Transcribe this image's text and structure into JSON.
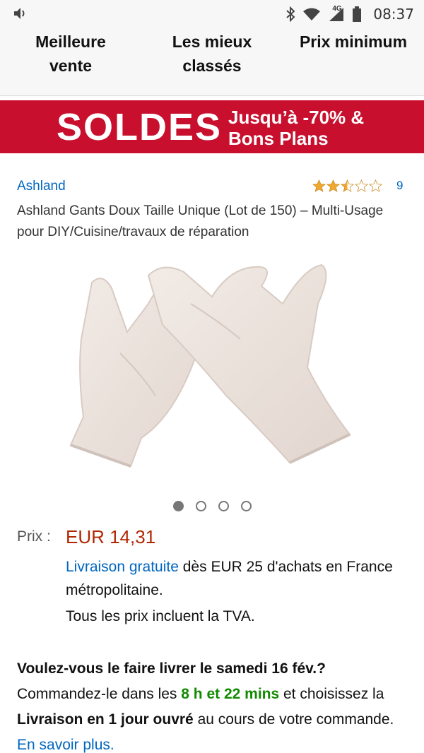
{
  "status_bar": {
    "time": "08:37",
    "network": "4G",
    "icons": [
      "volume-icon",
      "bluetooth-icon",
      "wifi-icon",
      "signal-icon",
      "battery-icon"
    ]
  },
  "sort_tabs": [
    {
      "label": "Meilleure\nvente"
    },
    {
      "label": "Les mieux\nclassés"
    },
    {
      "label": "Prix minimum"
    }
  ],
  "banner": {
    "title": "SOLDES",
    "subtitle": "Jusqu’à -70% &\nBons Plans",
    "color": "#c8102e"
  },
  "product": {
    "brand": "Ashland",
    "rating": 2.5,
    "rating_max": 5,
    "rating_count": "9",
    "title": "Ashland Gants Doux Taille Unique (Lot de 150) – Multi-Usage pour DIY/Cuisine/travaux de réparation",
    "image_icon": "gloves-image",
    "carousel_pages": 4,
    "carousel_active": 1
  },
  "price": {
    "label": "Prix :",
    "value": "EUR 14,31",
    "color": "#b12704"
  },
  "shipping": {
    "link": "Livraison gratuite",
    "text": " dès EUR 25 d'achats en France métropolitaine.",
    "tva": "Tous les prix incluent la TVA."
  },
  "delivery": {
    "question": "Voulez-vous le faire livrer le samedi 16 fév.?",
    "order_prefix": "Commandez-le dans les ",
    "countdown": "8 h et 22 mins",
    "order_mid": " et choisissez la ",
    "option": "Livraison en 1 jour ouvré",
    "order_suffix": " au cours de votre commande. ",
    "learn_more": "En savoir plus."
  },
  "colors": {
    "link": "#0066c0",
    "star": "#f0a830",
    "countdown": "#118a00"
  }
}
